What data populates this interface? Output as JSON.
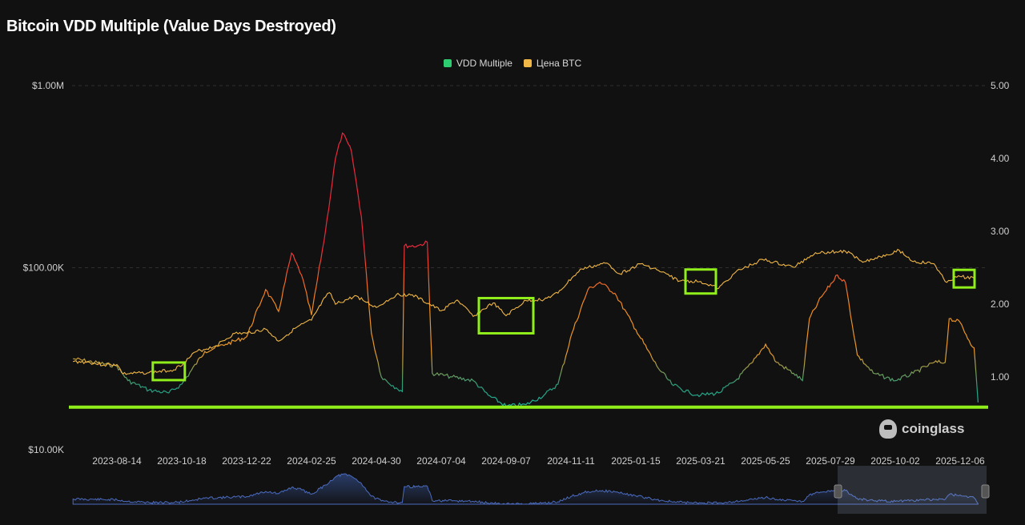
{
  "chart_data": {
    "type": "line",
    "title": "Bitcoin VDD Multiple (Value Days Destroyed)",
    "legend": [
      {
        "name": "VDD Multiple",
        "color": "#2ecc71"
      },
      {
        "name": "Цена BTC",
        "color": "#f0b646"
      }
    ],
    "legend_position": "top-center",
    "x_ticks": [
      "2023-08-14",
      "2023-10-18",
      "2023-12-22",
      "2024-02-25",
      "2024-04-30",
      "2024-07-04",
      "2024-09-07",
      "2024-11-11",
      "2025-01-15",
      "2025-03-21",
      "2025-05-25",
      "2025-07-29",
      "2025-10-02",
      "2025-12-06"
    ],
    "x_range": [
      "2023-07-01",
      "2025-12-26"
    ],
    "y_left": {
      "scale": "log",
      "ticks": [
        "$1.00M",
        "$100.00K",
        "$10.00K"
      ],
      "range": [
        10000,
        1000000
      ]
    },
    "y_right": {
      "ticks": [
        "5.00",
        "4.00",
        "3.00",
        "2.00",
        "1.00"
      ],
      "range": [
        0.6,
        5.0
      ]
    },
    "grid": true,
    "series": [
      {
        "name": "Цена BTC",
        "axis": "left",
        "color": "#f0b646",
        "points": [
          [
            "2023-07-01",
            30500
          ],
          [
            "2023-07-15",
            30300
          ],
          [
            "2023-08-01",
            29200
          ],
          [
            "2023-08-14",
            29400
          ],
          [
            "2023-08-20",
            26100
          ],
          [
            "2023-09-15",
            26500
          ],
          [
            "2023-10-10",
            27500
          ],
          [
            "2023-10-20",
            30000
          ],
          [
            "2023-11-01",
            34500
          ],
          [
            "2023-11-20",
            37000
          ],
          [
            "2023-12-10",
            43500
          ],
          [
            "2023-12-22",
            43600
          ],
          [
            "2024-01-10",
            46000
          ],
          [
            "2024-01-23",
            39500
          ],
          [
            "2024-02-10",
            47000
          ],
          [
            "2024-02-25",
            51500
          ],
          [
            "2024-03-10",
            69000
          ],
          [
            "2024-03-14",
            73000
          ],
          [
            "2024-03-20",
            63000
          ],
          [
            "2024-04-10",
            70000
          ],
          [
            "2024-04-20",
            64500
          ],
          [
            "2024-04-30",
            60500
          ],
          [
            "2024-05-20",
            71000
          ],
          [
            "2024-06-05",
            71000
          ],
          [
            "2024-07-04",
            58000
          ],
          [
            "2024-07-20",
            66500
          ],
          [
            "2024-08-05",
            54000
          ],
          [
            "2024-08-25",
            64000
          ],
          [
            "2024-09-07",
            54500
          ],
          [
            "2024-09-27",
            66000
          ],
          [
            "2024-10-15",
            67000
          ],
          [
            "2024-10-29",
            72500
          ],
          [
            "2024-11-12",
            88000
          ],
          [
            "2024-11-22",
            98500
          ],
          [
            "2024-12-17",
            106000
          ],
          [
            "2024-12-30",
            92500
          ],
          [
            "2025-01-20",
            105000
          ],
          [
            "2025-02-05",
            97500
          ],
          [
            "2025-02-28",
            84500
          ],
          [
            "2025-03-21",
            84000
          ],
          [
            "2025-04-08",
            77000
          ],
          [
            "2025-04-25",
            94500
          ],
          [
            "2025-05-22",
            111000
          ],
          [
            "2025-06-22",
            100500
          ],
          [
            "2025-07-14",
            121000
          ],
          [
            "2025-08-13",
            123000
          ],
          [
            "2025-09-01",
            108000
          ],
          [
            "2025-10-06",
            124500
          ],
          [
            "2025-10-20",
            108000
          ],
          [
            "2025-11-10",
            105000
          ],
          [
            "2025-11-21",
            84000
          ],
          [
            "2025-12-06",
            89500
          ],
          [
            "2025-12-20",
            87500
          ]
        ]
      },
      {
        "name": "VDD Multiple",
        "axis": "right",
        "color": "#2ecc71",
        "points": [
          [
            "2023-07-01",
            1.25
          ],
          [
            "2023-08-14",
            1.15
          ],
          [
            "2023-08-25",
            0.95
          ],
          [
            "2023-09-15",
            0.82
          ],
          [
            "2023-10-05",
            0.78
          ],
          [
            "2023-10-18",
            0.9
          ],
          [
            "2023-11-10",
            1.35
          ],
          [
            "2023-12-01",
            1.45
          ],
          [
            "2023-12-22",
            1.55
          ],
          [
            "2024-01-10",
            2.2
          ],
          [
            "2024-01-23",
            1.9
          ],
          [
            "2024-02-05",
            2.7
          ],
          [
            "2024-02-15",
            2.4
          ],
          [
            "2024-02-25",
            1.85
          ],
          [
            "2024-03-10",
            3.0
          ],
          [
            "2024-03-20",
            4.0
          ],
          [
            "2024-03-27",
            4.35
          ],
          [
            "2024-04-05",
            4.1
          ],
          [
            "2024-04-15",
            3.2
          ],
          [
            "2024-04-25",
            1.6
          ],
          [
            "2024-05-05",
            1.0
          ],
          [
            "2024-05-20",
            0.85
          ],
          [
            "2024-05-26",
            0.8
          ],
          [
            "2024-05-28",
            2.8
          ],
          [
            "2024-06-10",
            2.8
          ],
          [
            "2024-06-20",
            2.85
          ],
          [
            "2024-06-25",
            1.05
          ],
          [
            "2024-07-15",
            1.0
          ],
          [
            "2024-08-05",
            0.95
          ],
          [
            "2024-08-20",
            0.75
          ],
          [
            "2024-09-07",
            0.6
          ],
          [
            "2024-09-27",
            0.62
          ],
          [
            "2024-10-15",
            0.75
          ],
          [
            "2024-10-29",
            0.9
          ],
          [
            "2024-11-12",
            1.6
          ],
          [
            "2024-11-28",
            2.2
          ],
          [
            "2024-12-10",
            2.3
          ],
          [
            "2024-12-25",
            2.15
          ],
          [
            "2025-01-15",
            1.65
          ],
          [
            "2025-02-05",
            1.15
          ],
          [
            "2025-02-20",
            0.9
          ],
          [
            "2025-03-10",
            0.78
          ],
          [
            "2025-03-21",
            0.75
          ],
          [
            "2025-04-08",
            0.78
          ],
          [
            "2025-04-25",
            0.95
          ],
          [
            "2025-05-12",
            1.2
          ],
          [
            "2025-05-25",
            1.45
          ],
          [
            "2025-06-05",
            1.2
          ],
          [
            "2025-06-22",
            1.05
          ],
          [
            "2025-07-01",
            0.95
          ],
          [
            "2025-07-08",
            1.8
          ],
          [
            "2025-07-20",
            2.1
          ],
          [
            "2025-08-05",
            2.4
          ],
          [
            "2025-08-13",
            2.3
          ],
          [
            "2025-08-25",
            1.3
          ],
          [
            "2025-09-10",
            1.05
          ],
          [
            "2025-10-02",
            0.95
          ],
          [
            "2025-10-20",
            1.05
          ],
          [
            "2025-11-10",
            1.2
          ],
          [
            "2025-11-21",
            1.2
          ],
          [
            "2025-11-25",
            1.8
          ],
          [
            "2025-12-06",
            1.75
          ],
          [
            "2025-12-15",
            1.5
          ],
          [
            "2025-12-20",
            1.4
          ],
          [
            "2025-12-24",
            0.65
          ]
        ]
      }
    ],
    "annotations": [
      {
        "type": "box",
        "at": "2023-10-05"
      },
      {
        "type": "box",
        "at": "2024-09-07"
      },
      {
        "type": "box",
        "at": "2025-03-21"
      },
      {
        "type": "box",
        "at": "2025-12-10"
      },
      {
        "type": "horizontal-line",
        "at": 0.64
      }
    ],
    "highlight_color": "#90ee1a"
  },
  "watermark": "coinglass"
}
